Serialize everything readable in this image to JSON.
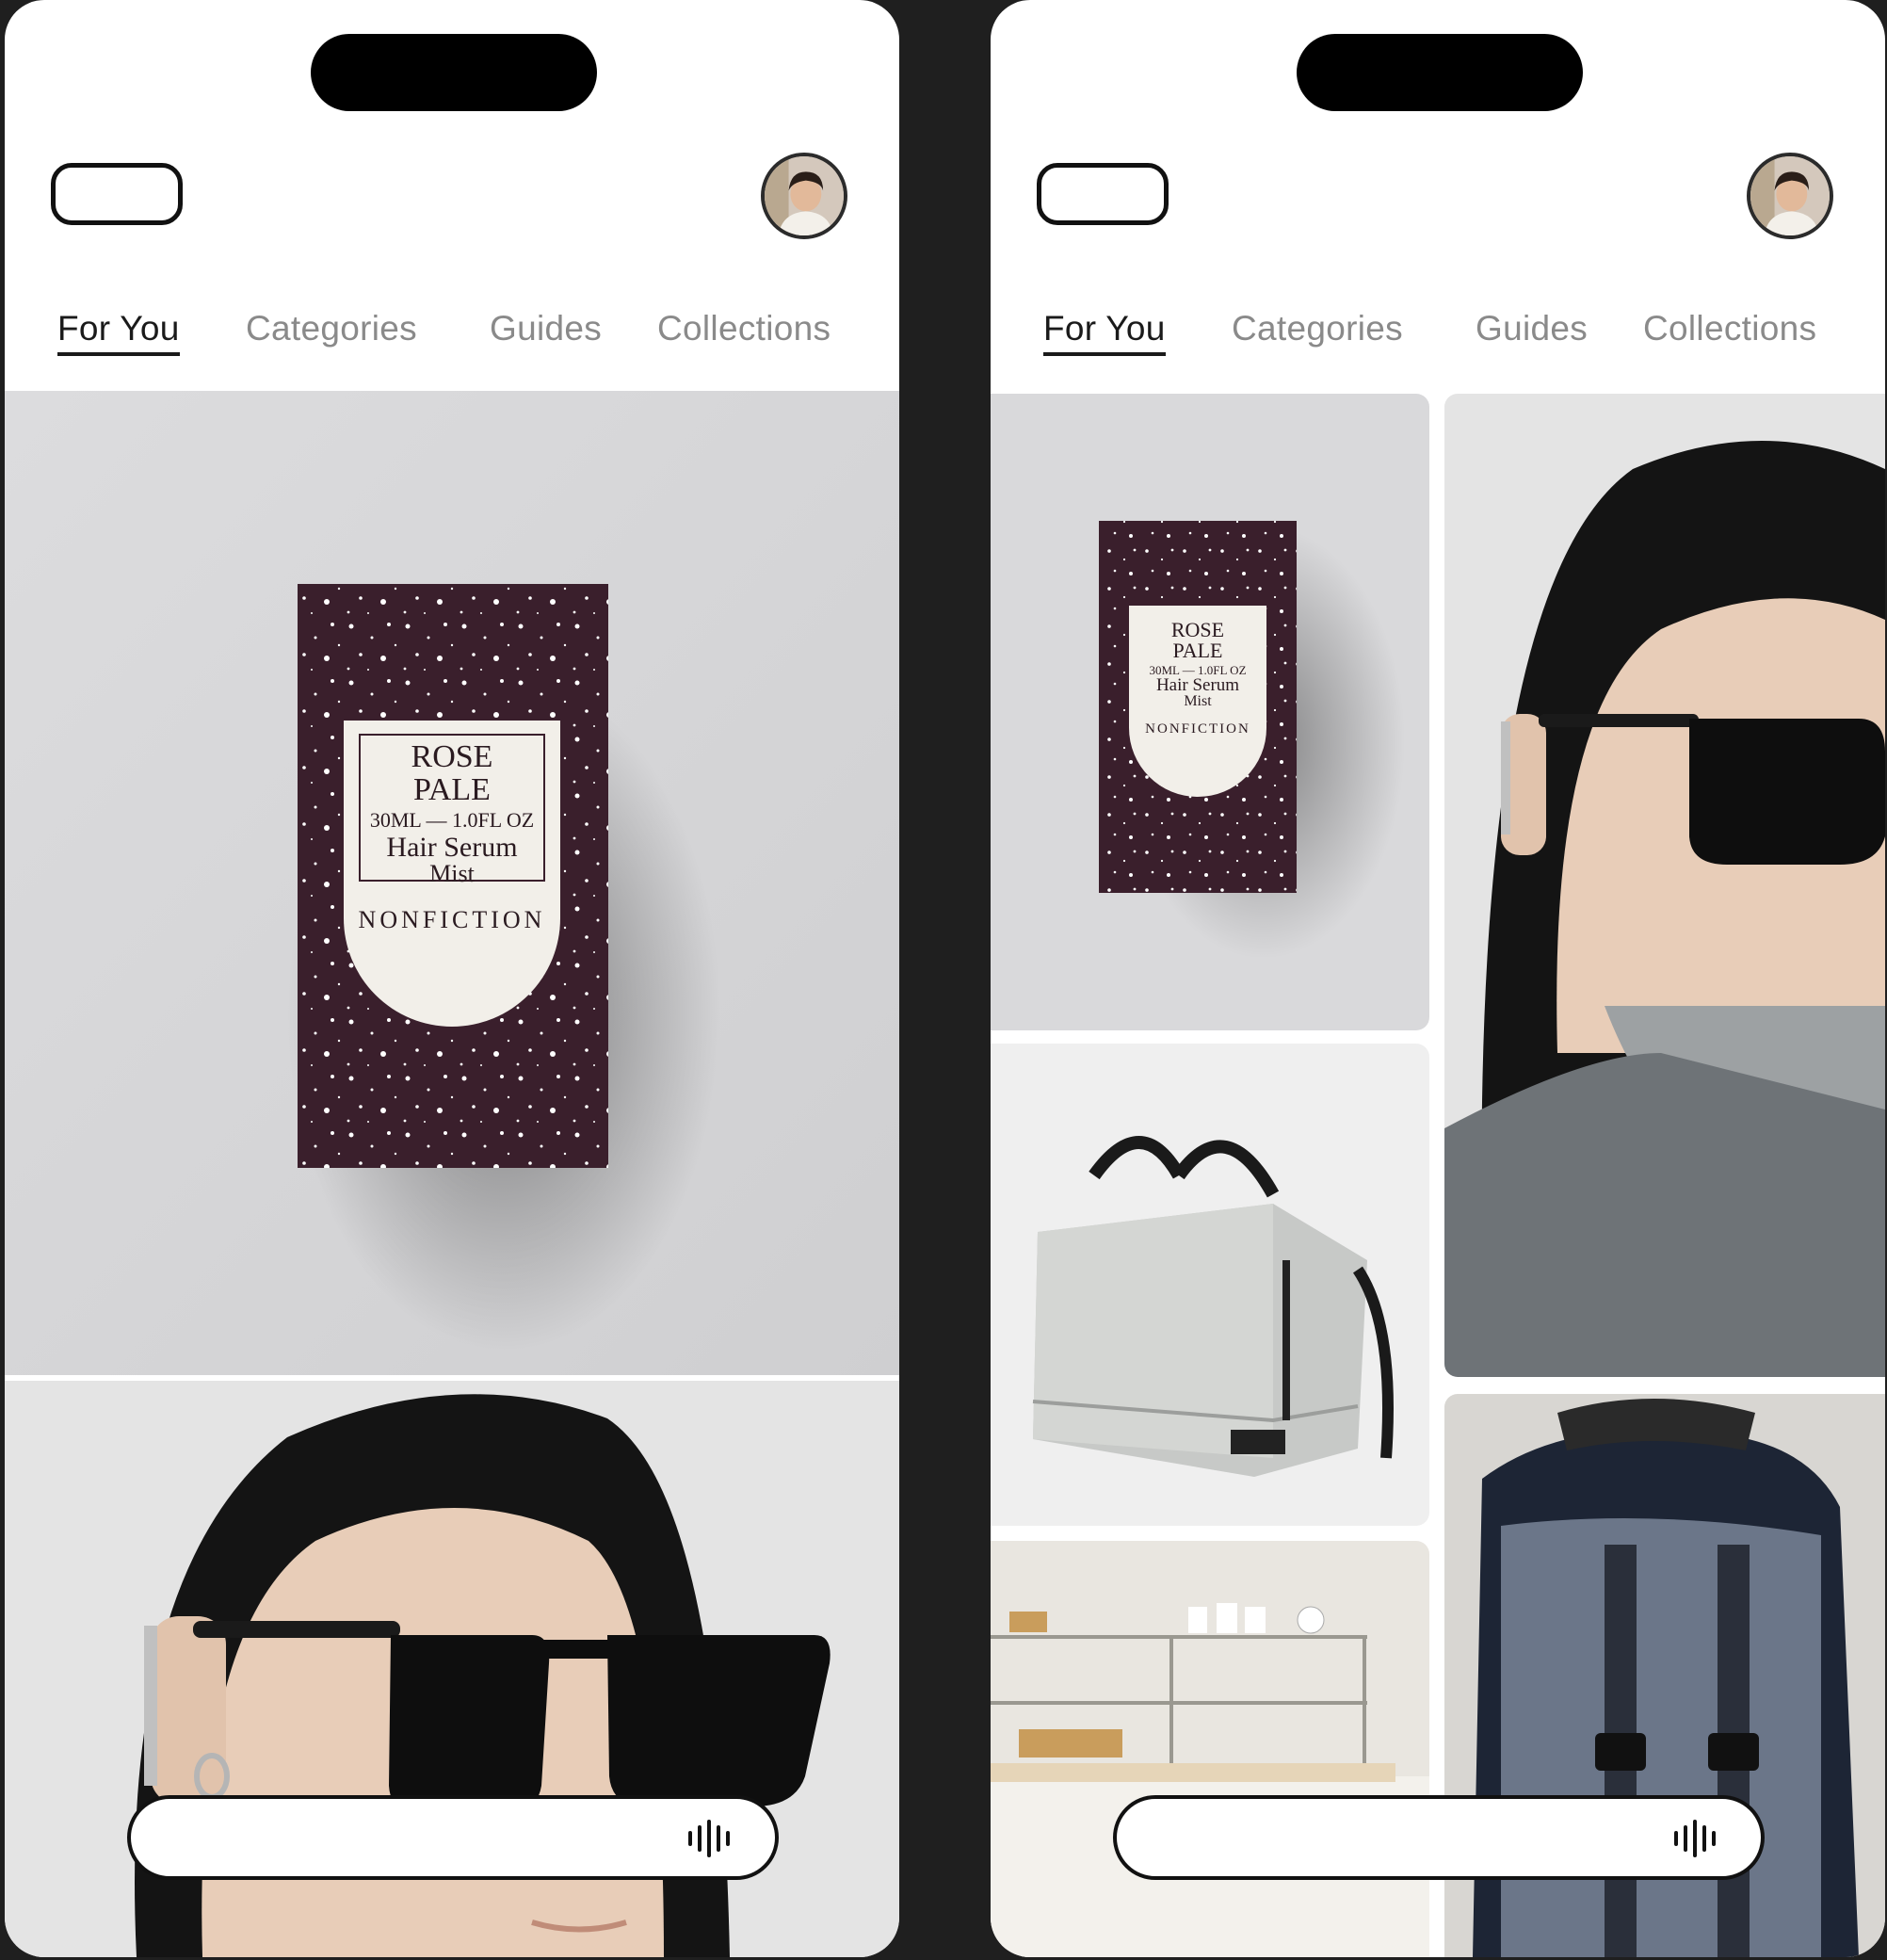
{
  "phones": [
    {
      "id": "left",
      "tabs": [
        {
          "label": "For You",
          "active": true
        },
        {
          "label": "Categories",
          "active": false
        },
        {
          "label": "Guides",
          "active": false
        },
        {
          "label": "Collections",
          "active": false
        }
      ],
      "search": {
        "placeholder": "",
        "voice_icon": "voice-wave-icon"
      }
    },
    {
      "id": "right",
      "tabs": [
        {
          "label": "For You",
          "active": true
        },
        {
          "label": "Categories",
          "active": false
        },
        {
          "label": "Guides",
          "active": false
        },
        {
          "label": "Collections",
          "active": false
        }
      ],
      "search": {
        "placeholder": "",
        "voice_icon": "voice-wave-icon"
      }
    }
  ],
  "product_box": {
    "line1": "ROSE",
    "line2": "PALE",
    "line3": "30ML — 1.0FL OZ",
    "line4": "Hair Serum",
    "line5": "Mist",
    "brand": "NONFICTION"
  },
  "colors": {
    "box": "#3a1f2c",
    "tile_bg": "#d9d9db",
    "tab_active": "#1a1a1a",
    "tab_inactive": "#8a8a8a"
  }
}
